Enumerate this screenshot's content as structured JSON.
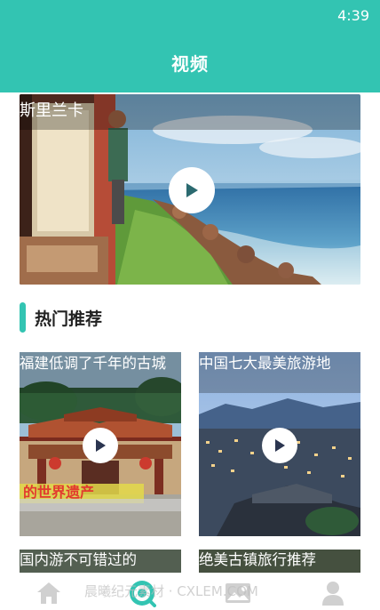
{
  "status_bar": {
    "time": "4:39"
  },
  "header": {
    "title": "视频"
  },
  "featured": {
    "caption": "斯里兰卡"
  },
  "section": {
    "title": "热门推荐"
  },
  "cards": [
    {
      "caption": "福建低调了千年的古城"
    },
    {
      "caption": "中国七大最美旅游地"
    },
    {
      "caption": "国内游不可错过的"
    },
    {
      "caption": "绝美古镇旅行推荐"
    }
  ],
  "banner_text": "的世界遗产",
  "bottom_nav": {
    "items": [
      {
        "icon": "home-icon"
      },
      {
        "icon": "video-icon",
        "active": true
      },
      {
        "icon": "image-icon"
      },
      {
        "icon": "user-icon"
      }
    ]
  },
  "watermark": "晨曦纪元素材 · CXLEM.COM",
  "colors": {
    "accent": "#33c4b2",
    "nav_inactive": "#d0d0d0"
  }
}
